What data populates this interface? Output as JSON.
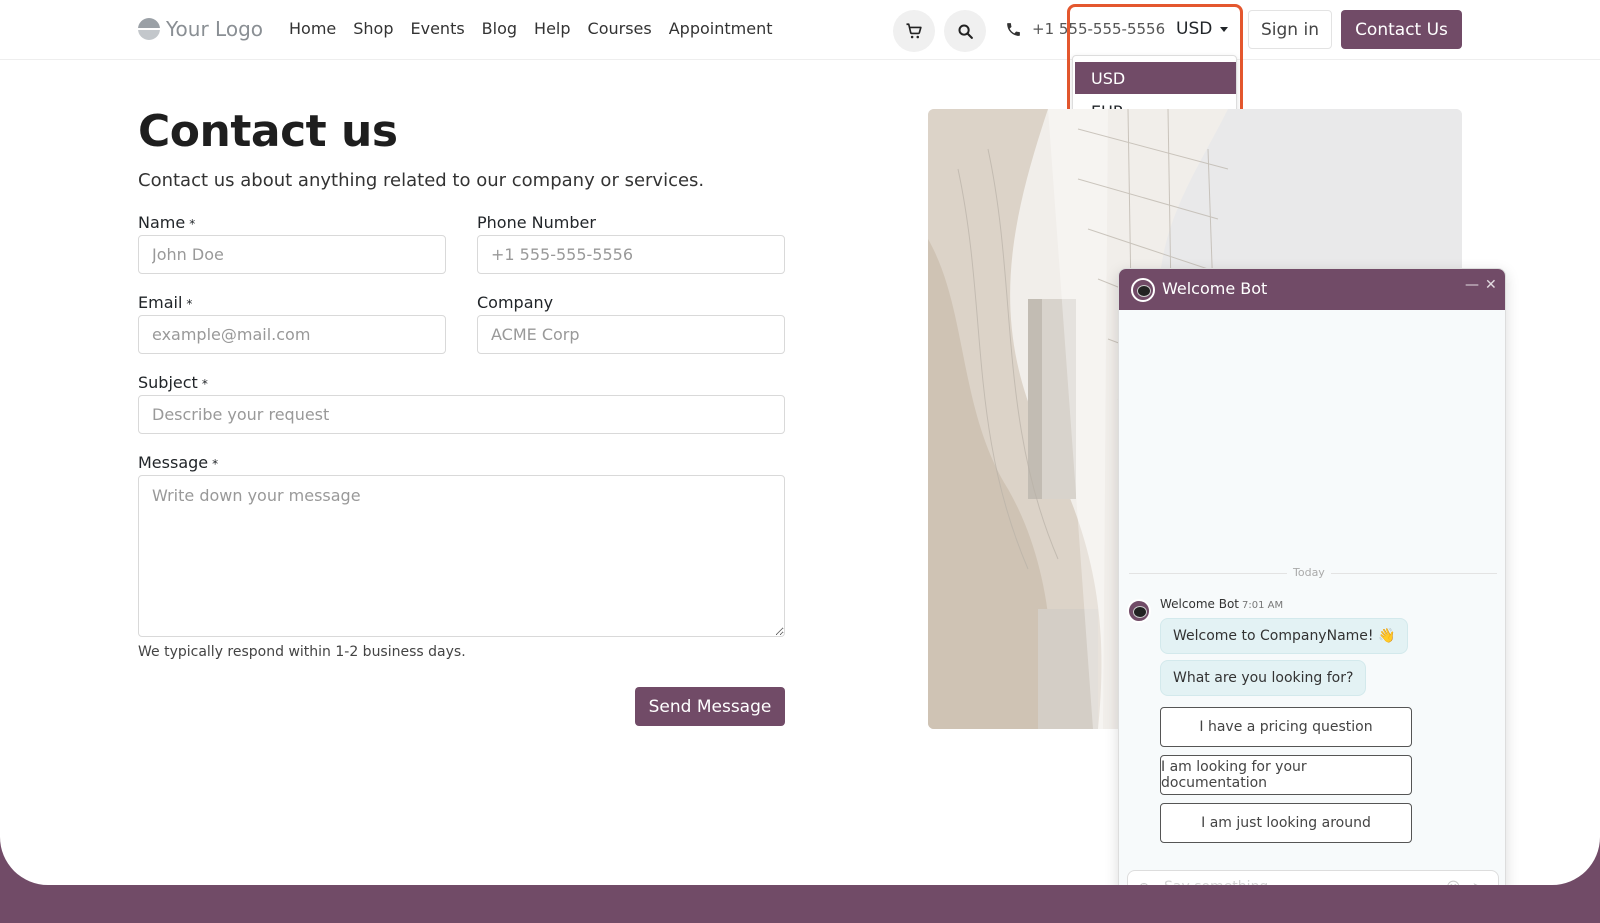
{
  "header": {
    "logo": "Your Logo",
    "nav": [
      "Home",
      "Shop",
      "Events",
      "Blog",
      "Help",
      "Courses",
      "Appointment"
    ],
    "phone": "+1 555-555-5556",
    "currency": "USD",
    "sign_in": "Sign in",
    "contact_us": "Contact Us"
  },
  "currency_dropdown": {
    "options": [
      "USD",
      "EUR"
    ],
    "selected": "USD"
  },
  "form": {
    "title": "Contact us",
    "subtitle": "Contact us about anything related to our company or services.",
    "name": {
      "label": "Name",
      "placeholder": "John Doe",
      "required": "*"
    },
    "phone": {
      "label": "Phone Number",
      "placeholder": "+1 555-555-5556"
    },
    "email": {
      "label": "Email",
      "placeholder": "example@mail.com",
      "required": "*"
    },
    "company": {
      "label": "Company",
      "placeholder": "ACME Corp"
    },
    "subject": {
      "label": "Subject",
      "placeholder": "Describe your request",
      "required": "*"
    },
    "message": {
      "label": "Message",
      "placeholder": "Write down your message",
      "required": "*"
    },
    "hint": "We typically respond within 1-2 business days.",
    "send": "Send Message"
  },
  "chat": {
    "title": "Welcome Bot",
    "day_separator": "Today",
    "author": "Welcome Bot",
    "time": "7:01 AM",
    "messages": [
      "Welcome to CompanyName! 👋",
      "What are you looking for?"
    ],
    "options": [
      "I have a pricing question",
      "I am looking for your documentation",
      "I am just looking around"
    ],
    "input_placeholder": "Say something..."
  },
  "colors": {
    "brand": "#714B67",
    "highlight": "#e4572e"
  }
}
